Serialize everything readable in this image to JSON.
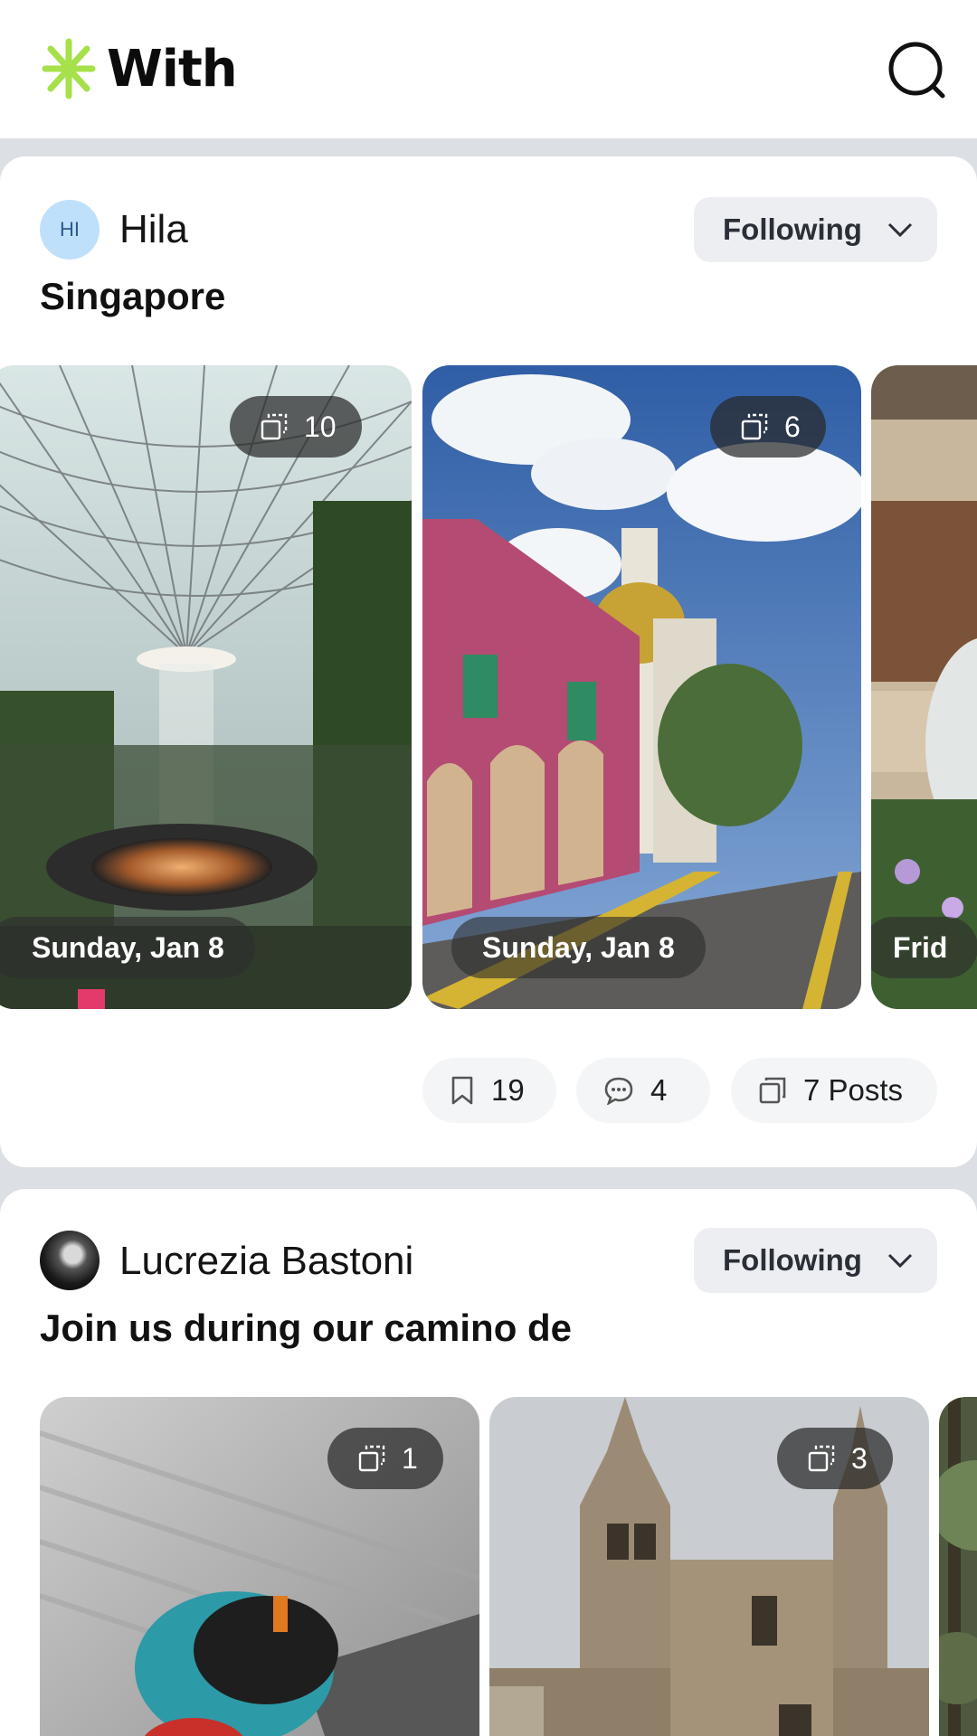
{
  "app": {
    "name": "With",
    "accent": "#a6e04a"
  },
  "header": {
    "search_icon": "search-icon"
  },
  "posts": [
    {
      "avatar_initials": "HI",
      "author": "Hila",
      "follow_label": "Following",
      "title": "Singapore",
      "photos": [
        {
          "count": "10",
          "date": "Sunday, Jan 8",
          "scene": "Jewel Changi Rain Vortex"
        },
        {
          "count": "6",
          "date": "Sunday, Jan 8",
          "scene": "Sultan Mosque street"
        },
        {
          "count": "",
          "date": "Frid",
          "scene": "indoor sculpture"
        }
      ],
      "stats": {
        "bookmarks": "19",
        "comments": "4",
        "posts": "7 Posts"
      }
    },
    {
      "avatar_initials": "",
      "author": "Lucrezia Bastoni",
      "follow_label": "Following",
      "title": "Join us during our camino de",
      "photos": [
        {
          "count": "1",
          "scene": "backpack on luggage belt"
        },
        {
          "count": "3",
          "scene": "Santiago de Compostela Cathedral"
        },
        {
          "count": "",
          "scene": "trees"
        }
      ]
    }
  ]
}
